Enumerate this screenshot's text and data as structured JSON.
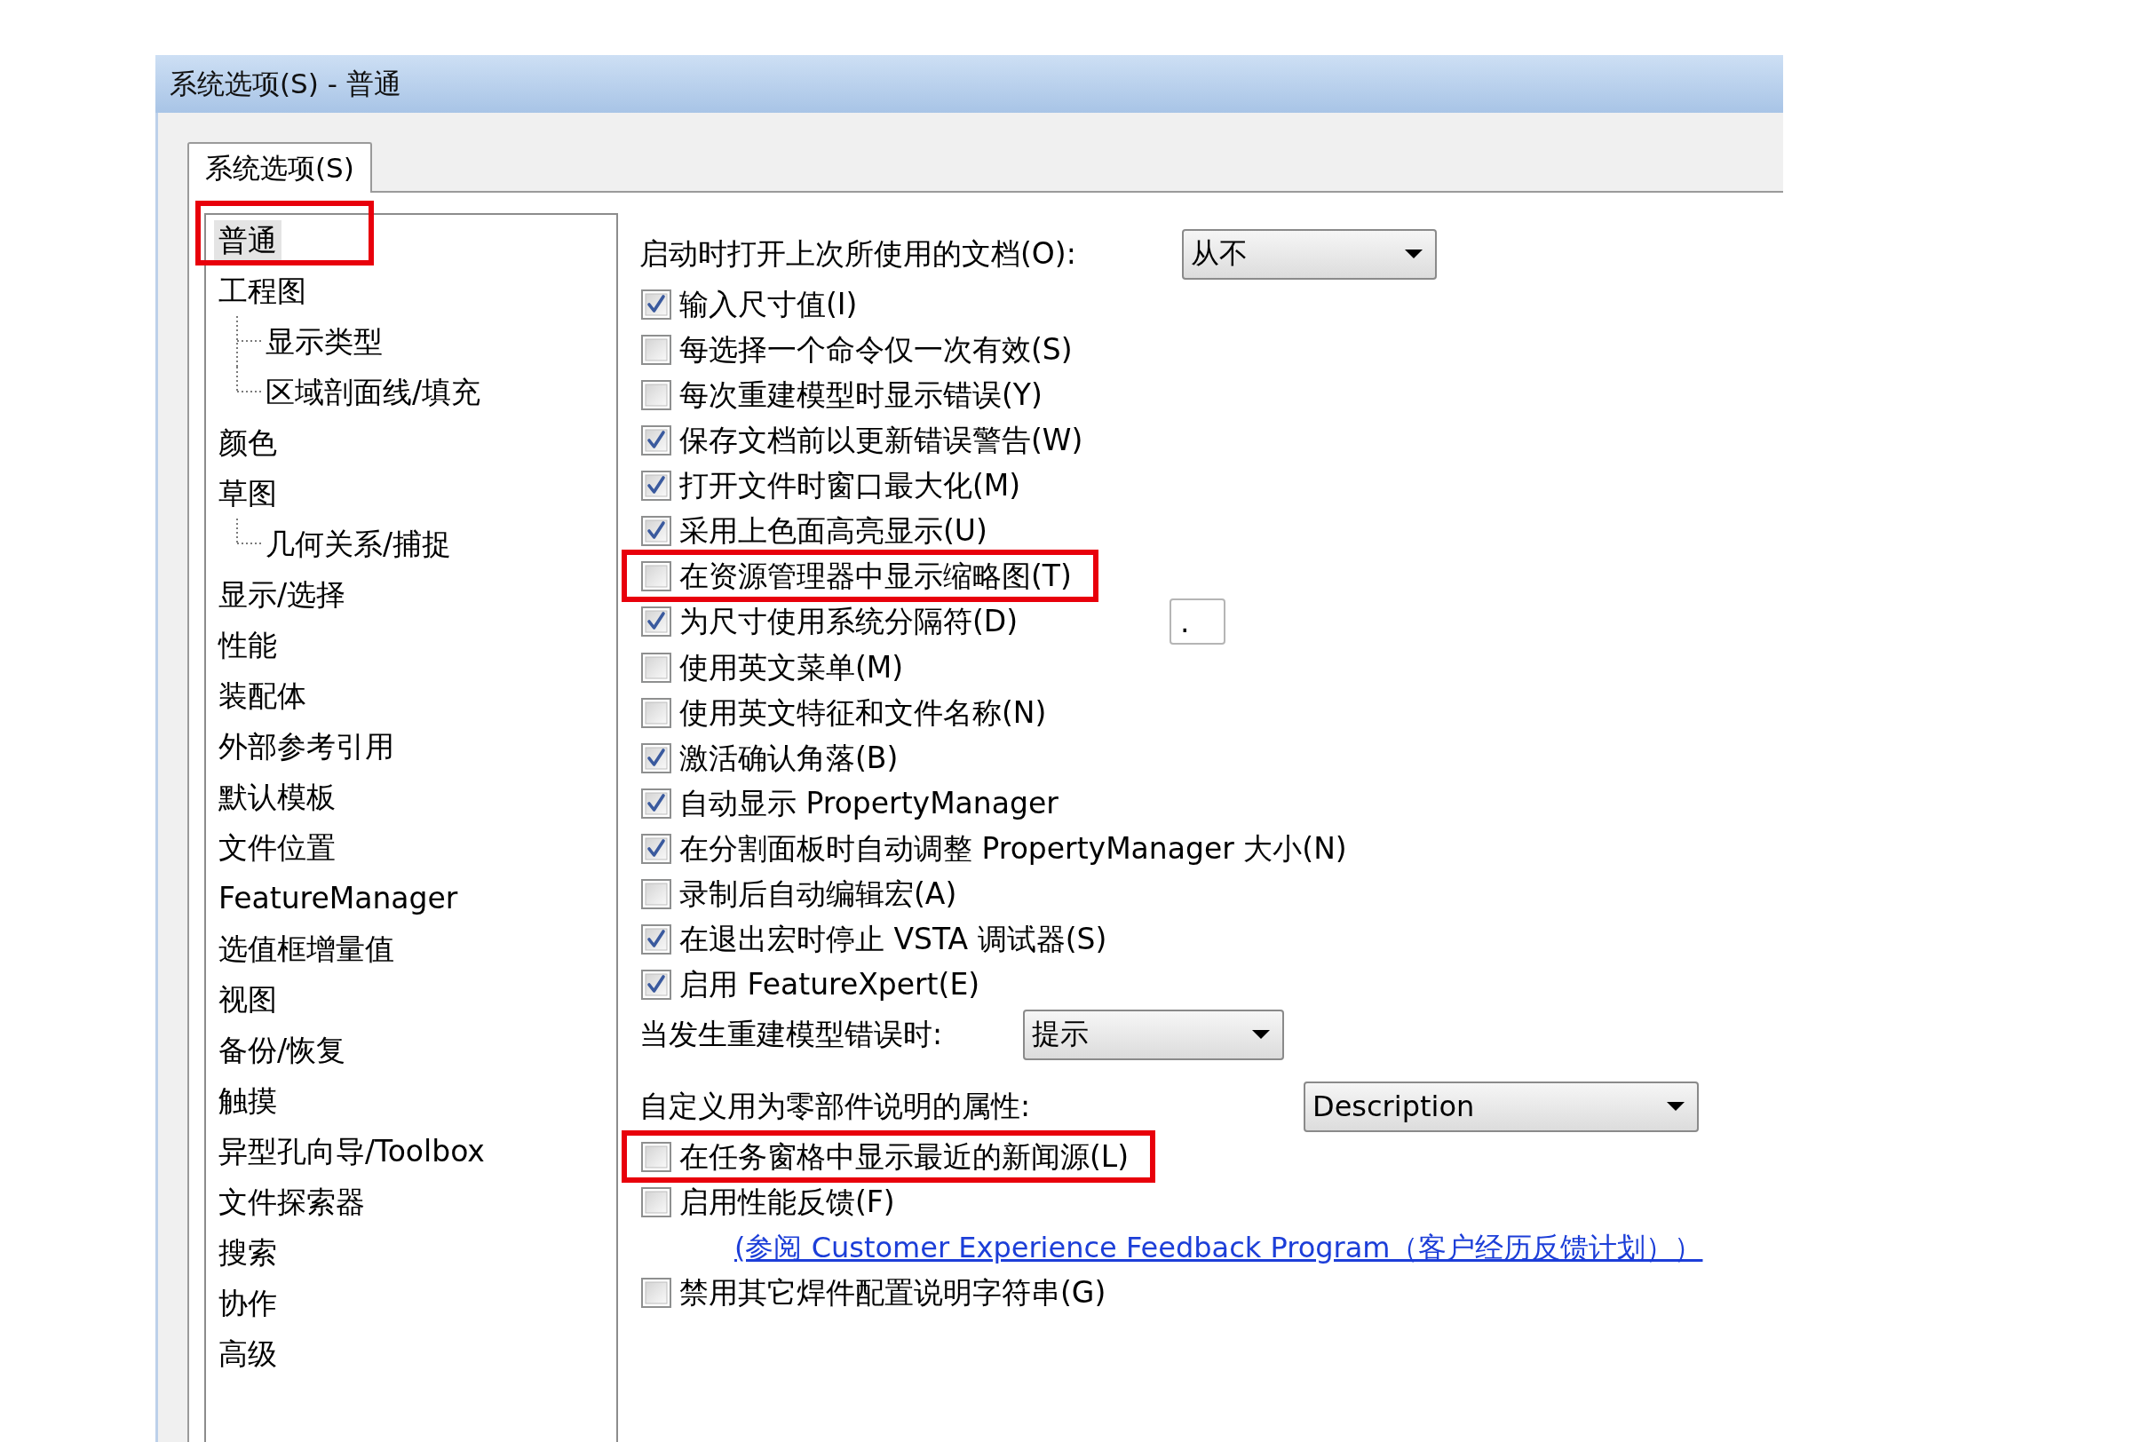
{
  "window": {
    "title": "系统选项(S) - 普通"
  },
  "tabs": [
    {
      "label": "系统选项(S)",
      "selected": true
    }
  ],
  "tree": [
    {
      "label": "普通",
      "selected": true,
      "highlighted": true
    },
    {
      "label": "工程图",
      "selected": false,
      "highlighted": false,
      "children": [
        {
          "label": "显示类型",
          "selected": false,
          "highlighted": false
        },
        {
          "label": "区域剖面线/填充",
          "selected": false,
          "highlighted": false
        }
      ]
    },
    {
      "label": "颜色",
      "selected": false,
      "highlighted": false
    },
    {
      "label": "草图",
      "selected": false,
      "highlighted": false,
      "children": [
        {
          "label": "几何关系/捕捉",
          "selected": false,
          "highlighted": false
        }
      ]
    },
    {
      "label": "显示/选择",
      "selected": false,
      "highlighted": false
    },
    {
      "label": "性能",
      "selected": false,
      "highlighted": false
    },
    {
      "label": "装配体",
      "selected": false,
      "highlighted": false
    },
    {
      "label": "外部参考引用",
      "selected": false,
      "highlighted": false
    },
    {
      "label": "默认模板",
      "selected": false,
      "highlighted": false
    },
    {
      "label": "文件位置",
      "selected": false,
      "highlighted": false
    },
    {
      "label": "FeatureManager",
      "selected": false,
      "highlighted": false
    },
    {
      "label": "选值框增量值",
      "selected": false,
      "highlighted": false
    },
    {
      "label": "视图",
      "selected": false,
      "highlighted": false
    },
    {
      "label": "备份/恢复",
      "selected": false,
      "highlighted": false
    },
    {
      "label": "触摸",
      "selected": false,
      "highlighted": false
    },
    {
      "label": "异型孔向导/Toolbox",
      "selected": false,
      "highlighted": false
    },
    {
      "label": "文件探索器",
      "selected": false,
      "highlighted": false
    },
    {
      "label": "搜索",
      "selected": false,
      "highlighted": false
    },
    {
      "label": "协作",
      "selected": false,
      "highlighted": false
    },
    {
      "label": "高级",
      "selected": false,
      "highlighted": false
    }
  ],
  "options": [
    {
      "kind": "dropdown",
      "label": "启动时打开上次所使用的文档(O):",
      "value": "从不",
      "highlighted": false
    },
    {
      "kind": "checkbox",
      "label": "输入尺寸值(I)",
      "checked": true,
      "highlighted": false
    },
    {
      "kind": "checkbox",
      "label": "每选择一个命令仅一次有效(S)",
      "checked": false,
      "highlighted": false
    },
    {
      "kind": "checkbox",
      "label": "每次重建模型时显示错误(Y)",
      "checked": false,
      "highlighted": false
    },
    {
      "kind": "checkbox",
      "label": "保存文档前以更新错误警告(W)",
      "checked": true,
      "highlighted": false
    },
    {
      "kind": "checkbox",
      "label": "打开文件时窗口最大化(M)",
      "checked": true,
      "highlighted": false
    },
    {
      "kind": "checkbox",
      "label": "采用上色面高亮显示(U)",
      "checked": true,
      "highlighted": false
    },
    {
      "kind": "checkbox",
      "label": "在资源管理器中显示缩略图(T)",
      "checked": false,
      "highlighted": true
    },
    {
      "kind": "checkbox",
      "label": "为尺寸使用系统分隔符(D)",
      "checked": true,
      "highlighted": false,
      "field": {
        "value": "."
      }
    },
    {
      "kind": "checkbox",
      "label": "使用英文菜单(M)",
      "checked": false,
      "highlighted": false
    },
    {
      "kind": "checkbox",
      "label": "使用英文特征和文件名称(N)",
      "checked": false,
      "highlighted": false
    },
    {
      "kind": "checkbox",
      "label": "激活确认角落(B)",
      "checked": true,
      "highlighted": false
    },
    {
      "kind": "checkbox",
      "label": "自动显示 PropertyManager",
      "checked": true,
      "highlighted": false
    },
    {
      "kind": "checkbox",
      "label": "在分割面板时自动调整 PropertyManager 大小(N)",
      "checked": true,
      "highlighted": false
    },
    {
      "kind": "checkbox",
      "label": "录制后自动编辑宏(A)",
      "checked": false,
      "highlighted": false
    },
    {
      "kind": "checkbox",
      "label": "在退出宏时停止 VSTA 调试器(S)",
      "checked": true,
      "highlighted": false
    },
    {
      "kind": "checkbox",
      "label": "启用 FeatureXpert(E)",
      "checked": true,
      "highlighted": false
    },
    {
      "kind": "dropdown",
      "label": "当发生重建模型错误时:",
      "value": "提示",
      "highlighted": false
    },
    {
      "kind": "dropdown",
      "label": "自定义用为零部件说明的属性:",
      "value": "Description",
      "highlighted": false
    },
    {
      "kind": "checkbox",
      "label": "在任务窗格中显示最近的新闻源(L)",
      "checked": false,
      "highlighted": true
    },
    {
      "kind": "checkbox",
      "label": "启用性能反馈(F)",
      "checked": false,
      "highlighted": false
    },
    {
      "kind": "link",
      "label": "(参阅 Customer Experience Feedback Program（客户经历反馈计划））",
      "highlighted": false
    },
    {
      "kind": "checkbox",
      "label": "禁用其它焊件配置说明字符串(G)",
      "checked": false,
      "highlighted": false
    }
  ]
}
